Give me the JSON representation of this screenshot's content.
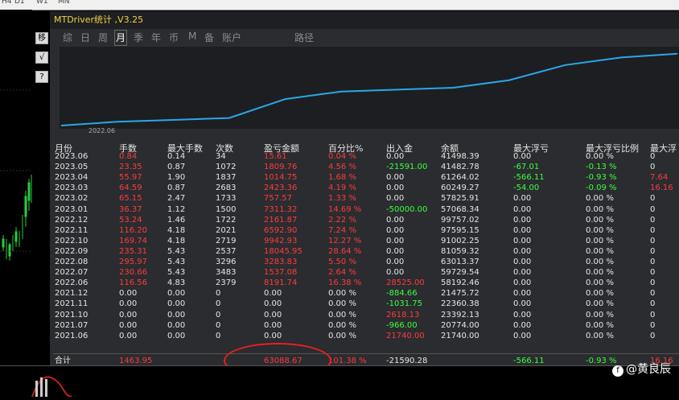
{
  "topbar": [
    "H4",
    "D1",
    "W1",
    "MN"
  ],
  "tools": [
    "移",
    "√",
    "?"
  ],
  "window": {
    "title": "MTDriver统计 ,V3.25"
  },
  "tabs": [
    "综",
    "日",
    "周",
    "月",
    "季",
    "年",
    "币",
    "M",
    "备",
    "账户",
    "路径"
  ],
  "active_tab": "月",
  "curve": {
    "x_tick": "2022.06"
  },
  "table": {
    "headers": [
      "月份",
      "手数",
      "最大手数",
      "次数",
      "盈亏金额",
      "百分比%",
      "出入金",
      "余额",
      "最大浮亏",
      "最大浮亏比例",
      "最大浮"
    ],
    "rows": [
      [
        "2023.06",
        "0.84",
        "0.14",
        "34",
        "15.61",
        "0.04 %",
        "0.00",
        "41498.39",
        "0.00",
        "0.00 %",
        "0"
      ],
      [
        "2023.05",
        "23.35",
        "0.87",
        "1072",
        "1809.76",
        "4.56 %",
        "-21591.00",
        "41482.78",
        "-67.01",
        "-0.13 %",
        "0"
      ],
      [
        "2023.04",
        "55.97",
        "1.90",
        "1837",
        "1014.75",
        "1.68 %",
        "0.00",
        "61264.02",
        "-566.11",
        "-0.93 %",
        "7.64"
      ],
      [
        "2023.03",
        "64.59",
        "0.87",
        "2683",
        "2423.36",
        "4.19 %",
        "0.00",
        "60249.27",
        "-54.00",
        "-0.09 %",
        "16.16"
      ],
      [
        "2023.02",
        "65.15",
        "2.47",
        "1733",
        "757.57",
        "1.33 %",
        "0.00",
        "57825.91",
        "0.00",
        "0.00 %",
        "0"
      ],
      [
        "2023.01",
        "36.37",
        "1.12",
        "1500",
        "7311.32",
        "14.69 %",
        "-50000.00",
        "57068.34",
        "0.00",
        "0.00 %",
        "0"
      ],
      [
        "2022.12",
        "53.24",
        "1.46",
        "1722",
        "2161.87",
        "2.22 %",
        "0.00",
        "99757.02",
        "0.00",
        "0.00 %",
        "0"
      ],
      [
        "2022.11",
        "116.20",
        "4.18",
        "2021",
        "6592.90",
        "7.24 %",
        "0.00",
        "97595.15",
        "0.00",
        "0.00 %",
        "0"
      ],
      [
        "2022.10",
        "169.74",
        "4.18",
        "2719",
        "9942.93",
        "12.27 %",
        "0.00",
        "91002.25",
        "0.00",
        "0.00 %",
        "0"
      ],
      [
        "2022.09",
        "235.31",
        "5.43",
        "2537",
        "18045.95",
        "28.64 %",
        "0.00",
        "81059.32",
        "0.00",
        "0.00 %",
        "0"
      ],
      [
        "2022.08",
        "295.97",
        "5.43",
        "3296",
        "3283.83",
        "5.50 %",
        "0.00",
        "63013.37",
        "0.00",
        "0.00 %",
        "0"
      ],
      [
        "2022.07",
        "230.66",
        "5.43",
        "3483",
        "1537.08",
        "2.64 %",
        "0.00",
        "59729.54",
        "0.00",
        "0.00 %",
        "0"
      ],
      [
        "2022.06",
        "116.56",
        "4.83",
        "2379",
        "8191.74",
        "16.38 %",
        "28525.00",
        "58192.46",
        "0.00",
        "0.00 %",
        "0"
      ],
      [
        "2021.12",
        "0.00",
        "0.00",
        "0",
        "0.00",
        "0.00 %",
        "-884.66",
        "21475.72",
        "0.00",
        "0.00 %",
        "0"
      ],
      [
        "2021.11",
        "0.00",
        "0.00",
        "0",
        "0.00",
        "0.00 %",
        "-1031.75",
        "22360.38",
        "0.00",
        "0.00 %",
        "0"
      ],
      [
        "2021.10",
        "0.00",
        "0.00",
        "0",
        "0.00",
        "0.00 %",
        "2618.13",
        "23392.13",
        "0.00",
        "0.00 %",
        "0"
      ],
      [
        "2021.07",
        "0.00",
        "0.00",
        "0",
        "0.00",
        "0.00 %",
        "-966.00",
        "20774.00",
        "0.00",
        "0.00 %",
        "0"
      ],
      [
        "2021.06",
        "0.00",
        "0.00",
        "0",
        "0.00",
        "0.00 %",
        "21740.00",
        "21740.00",
        "0.00",
        "0.00 %",
        "0"
      ]
    ],
    "total": [
      "合计",
      "1463.95",
      "",
      "",
      "63088.67",
      "101.38 %",
      "-21590.28",
      "",
      "-566.11",
      "-0.93 %",
      "16.16"
    ]
  },
  "curve_values": [
    0,
    2,
    3,
    4,
    14,
    18,
    19,
    20,
    24,
    32,
    36,
    38
  ],
  "watermark": {
    "logo": "f",
    "text": "@黄良辰"
  },
  "colors": {
    "positive": "#ff3b3b",
    "negative": "#3cff3c",
    "text": "#e6e6e6",
    "title": "#f0d240",
    "curve": "#29a8e8"
  }
}
